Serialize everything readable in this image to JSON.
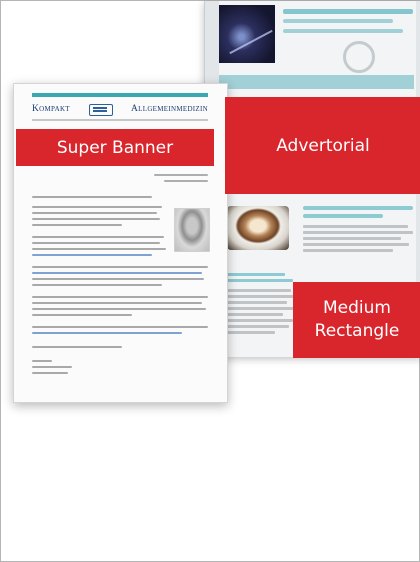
{
  "newsletter": {
    "masthead_left": "Kompakt",
    "masthead_right": "Allgemeinmedizin"
  },
  "ad_labels": {
    "super_banner": "Super Banner",
    "advertorial": "Advertorial",
    "medium_rectangle_line1": "Medium",
    "medium_rectangle_line2": "Rectangle"
  },
  "colors": {
    "ad_red": "#d9262d",
    "accent_teal": "#3aa7b3",
    "masthead_navy": "#1b3b6f"
  }
}
